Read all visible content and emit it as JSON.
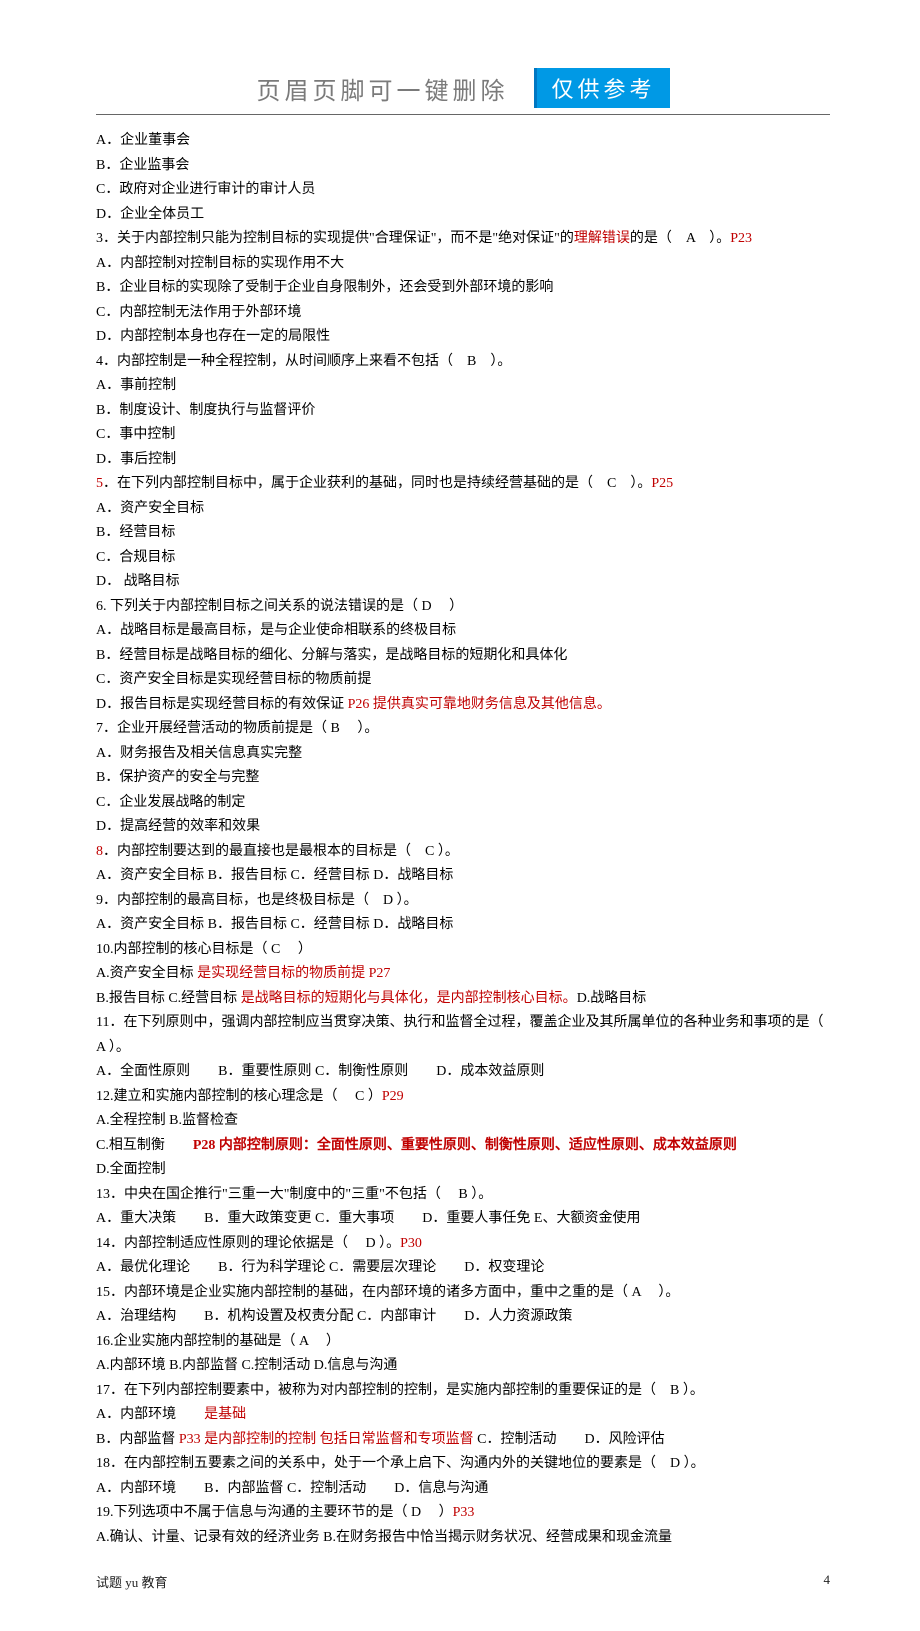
{
  "header": {
    "title": "页眉页脚可一键删除",
    "badge": "仅供参考"
  },
  "lines": [
    [
      {
        "t": "A．企业董事会"
      }
    ],
    [
      {
        "t": "B．企业监事会"
      }
    ],
    [
      {
        "t": "C．政府对企业进行审计的审计人员"
      }
    ],
    [
      {
        "t": "D．企业全体员工"
      }
    ],
    [
      {
        "t": "3．关于内部控制只能为控制目标的实现提供\"合理保证\"，而不是\"绝对保证\"的"
      },
      {
        "t": "理解错误",
        "c": "red"
      },
      {
        "t": "的是（　A　）。"
      },
      {
        "t": "P23",
        "c": "red"
      }
    ],
    [
      {
        "t": "A．内部控制对控制目标的实现作用不大"
      }
    ],
    [
      {
        "t": "B．企业目标的实现除了受制于企业自身限制外，还会受到外部环境的影响"
      }
    ],
    [
      {
        "t": "C．内部控制无法作用于外部环境"
      }
    ],
    [
      {
        "t": "D．内部控制本身也存在一定的局限性"
      }
    ],
    [
      {
        "t": "4．内部控制是一种全程控制，从时间顺序上来看不包括（　B　）。"
      }
    ],
    [
      {
        "t": "A．事前控制"
      }
    ],
    [
      {
        "t": "B．制度设计、制度执行与监督评价"
      }
    ],
    [
      {
        "t": "C．事中控制"
      }
    ],
    [
      {
        "t": "D．事后控制"
      }
    ],
    [
      {
        "t": "5",
        "c": "red"
      },
      {
        "t": "．在下列内部控制目标中，属于企业获利的基础，同时也是持续经营基础的是（　C　）。"
      },
      {
        "t": "P25",
        "c": "red"
      }
    ],
    [
      {
        "t": "A．资产安全目标"
      }
    ],
    [
      {
        "t": "B．经营目标"
      }
    ],
    [
      {
        "t": "C．合规目标"
      }
    ],
    [
      {
        "t": "D．  战略目标"
      }
    ],
    [
      {
        "t": "6. 下列关于内部控制目标之间关系的说法错误的是（ D　  ）"
      }
    ],
    [
      {
        "t": "A．战略目标是最高目标，是与企业使命相联系的终极目标"
      }
    ],
    [
      {
        "t": "B．经营目标是战略目标的细化、分解与落实，是战略目标的短期化和具体化"
      }
    ],
    [
      {
        "t": "C．资产安全目标是实现经营目标的物质前提"
      }
    ],
    [
      {
        "t": "D．报告目标是实现经营目标的有效保证 "
      },
      {
        "t": "P26 提供真实可靠地财务信息及其他信息。",
        "c": "red"
      }
    ],
    [
      {
        "t": "7．企业开展经营活动的物质前提是（ B　  ）。"
      }
    ],
    [
      {
        "t": "A．财务报告及相关信息真实完整"
      }
    ],
    [
      {
        "t": "B．保护资产的安全与完整"
      }
    ],
    [
      {
        "t": "C．企业发展战略的制定"
      }
    ],
    [
      {
        "t": "D．提高经营的效率和效果"
      }
    ],
    [
      {
        "t": "8",
        "c": "red"
      },
      {
        "t": "．内部控制要达到的最直接也是最根本的目标是（　C  ）。"
      }
    ],
    [
      {
        "t": "A．资产安全目标 B．报告目标 C．经营目标 D．战略目标"
      }
    ],
    [
      {
        "t": "9．内部控制的最高目标，也是终极目标是（　D ）。"
      }
    ],
    [
      {
        "t": "A．资产安全目标 B．报告目标 C．经营目标 D．战略目标"
      }
    ],
    [
      {
        "t": "10.内部控制的核心目标是（  C　  ）"
      }
    ],
    [
      {
        "t": "A.资产安全目标   "
      },
      {
        "t": "是实现经营目标的物质前提 P27",
        "c": "red"
      }
    ],
    [
      {
        "t": "B.报告目标 C.经营目标   "
      },
      {
        "t": "是战略目标的短期化与具体化，是内部控制核心目标。",
        "c": "red"
      },
      {
        "t": "D.战略目标"
      }
    ],
    [
      {
        "t": "11．在下列原则中，强调内部控制应当贯穿决策、执行和监督全过程，覆盖企业及其所属单位的各种业务和事项的是（  A  ）。"
      }
    ],
    [
      {
        "t": "A．全面性原则　　B．重要性原则 C．制衡性原则　　D．成本效益原则"
      }
    ],
    [
      {
        "t": "12.建立和实施内部控制的核心理念是（　 C ）"
      },
      {
        "t": "P29",
        "c": "red"
      }
    ],
    [
      {
        "t": "A.全程控制 B.监督检查"
      }
    ],
    [
      {
        "t": "C.相互制衡　　"
      },
      {
        "t": "P28 内部控制原则：全面性原则、重要性原则、制衡性原则、适应性原则、成本效益原则",
        "c": "red bold"
      }
    ],
    [
      {
        "t": "D.全面控制"
      }
    ],
    [
      {
        "t": "13．中央在国企推行\"三重一大\"制度中的\"三重\"不包括（　  B ）。"
      }
    ],
    [
      {
        "t": "A．重大决策　　B．重大政策变更 C．重大事项　　D．重要人事任免  E、大额资金使用"
      }
    ],
    [
      {
        "t": "14．内部控制适应性原则的理论依据是（　 D ）。"
      },
      {
        "t": "P30",
        "c": "red"
      }
    ],
    [
      {
        "t": "A．最优化理论　　B．行为科学理论 C．需要层次理论　　D．权变理论"
      }
    ],
    [
      {
        "t": "15．内部环境是企业实施内部控制的基础，在内部环境的诸多方面中，重中之重的是（ A　  ）。"
      }
    ],
    [
      {
        "t": "A．治理结构　　B．机构设置及权责分配 C．内部审计　　D．人力资源政策"
      }
    ],
    [
      {
        "t": "16.企业实施内部控制的基础是（ A　 ）"
      }
    ],
    [
      {
        "t": "A.内部环境 B.内部监督 C.控制活动 D.信息与沟通"
      }
    ],
    [
      {
        "t": "17．在下列内部控制要素中，被称为对内部控制的控制，是实施内部控制的重要保证的是（　B  ）。"
      }
    ],
    [
      {
        "t": "A．内部环境　　"
      },
      {
        "t": "是基础",
        "c": "red"
      }
    ],
    [
      {
        "t": "B．内部监督 "
      },
      {
        "t": "P33 是内部控制的控制 包括日常监督和专项监督 ",
        "c": "red"
      },
      {
        "t": "C．控制活动　　D．风险评估"
      }
    ],
    [
      {
        "t": "18．在内部控制五要素之间的关系中，处于一个承上启下、沟通内外的关键地位的要素是（　D  ）。"
      }
    ],
    [
      {
        "t": "A．内部环境　　B．内部监督 C．控制活动　　D．信息与沟通"
      }
    ],
    [
      {
        "t": "19.下列选项中不属于信息与沟通的主要环节的是（ D　 ）"
      },
      {
        "t": "P33",
        "c": "red"
      }
    ],
    [
      {
        "t": "A.确认、计量、记录有效的经济业务 B.在财务报告中恰当揭示财务状况、经营成果和现金流量"
      }
    ]
  ],
  "footer": {
    "left": "试题 yu 教育",
    "right": "4"
  }
}
